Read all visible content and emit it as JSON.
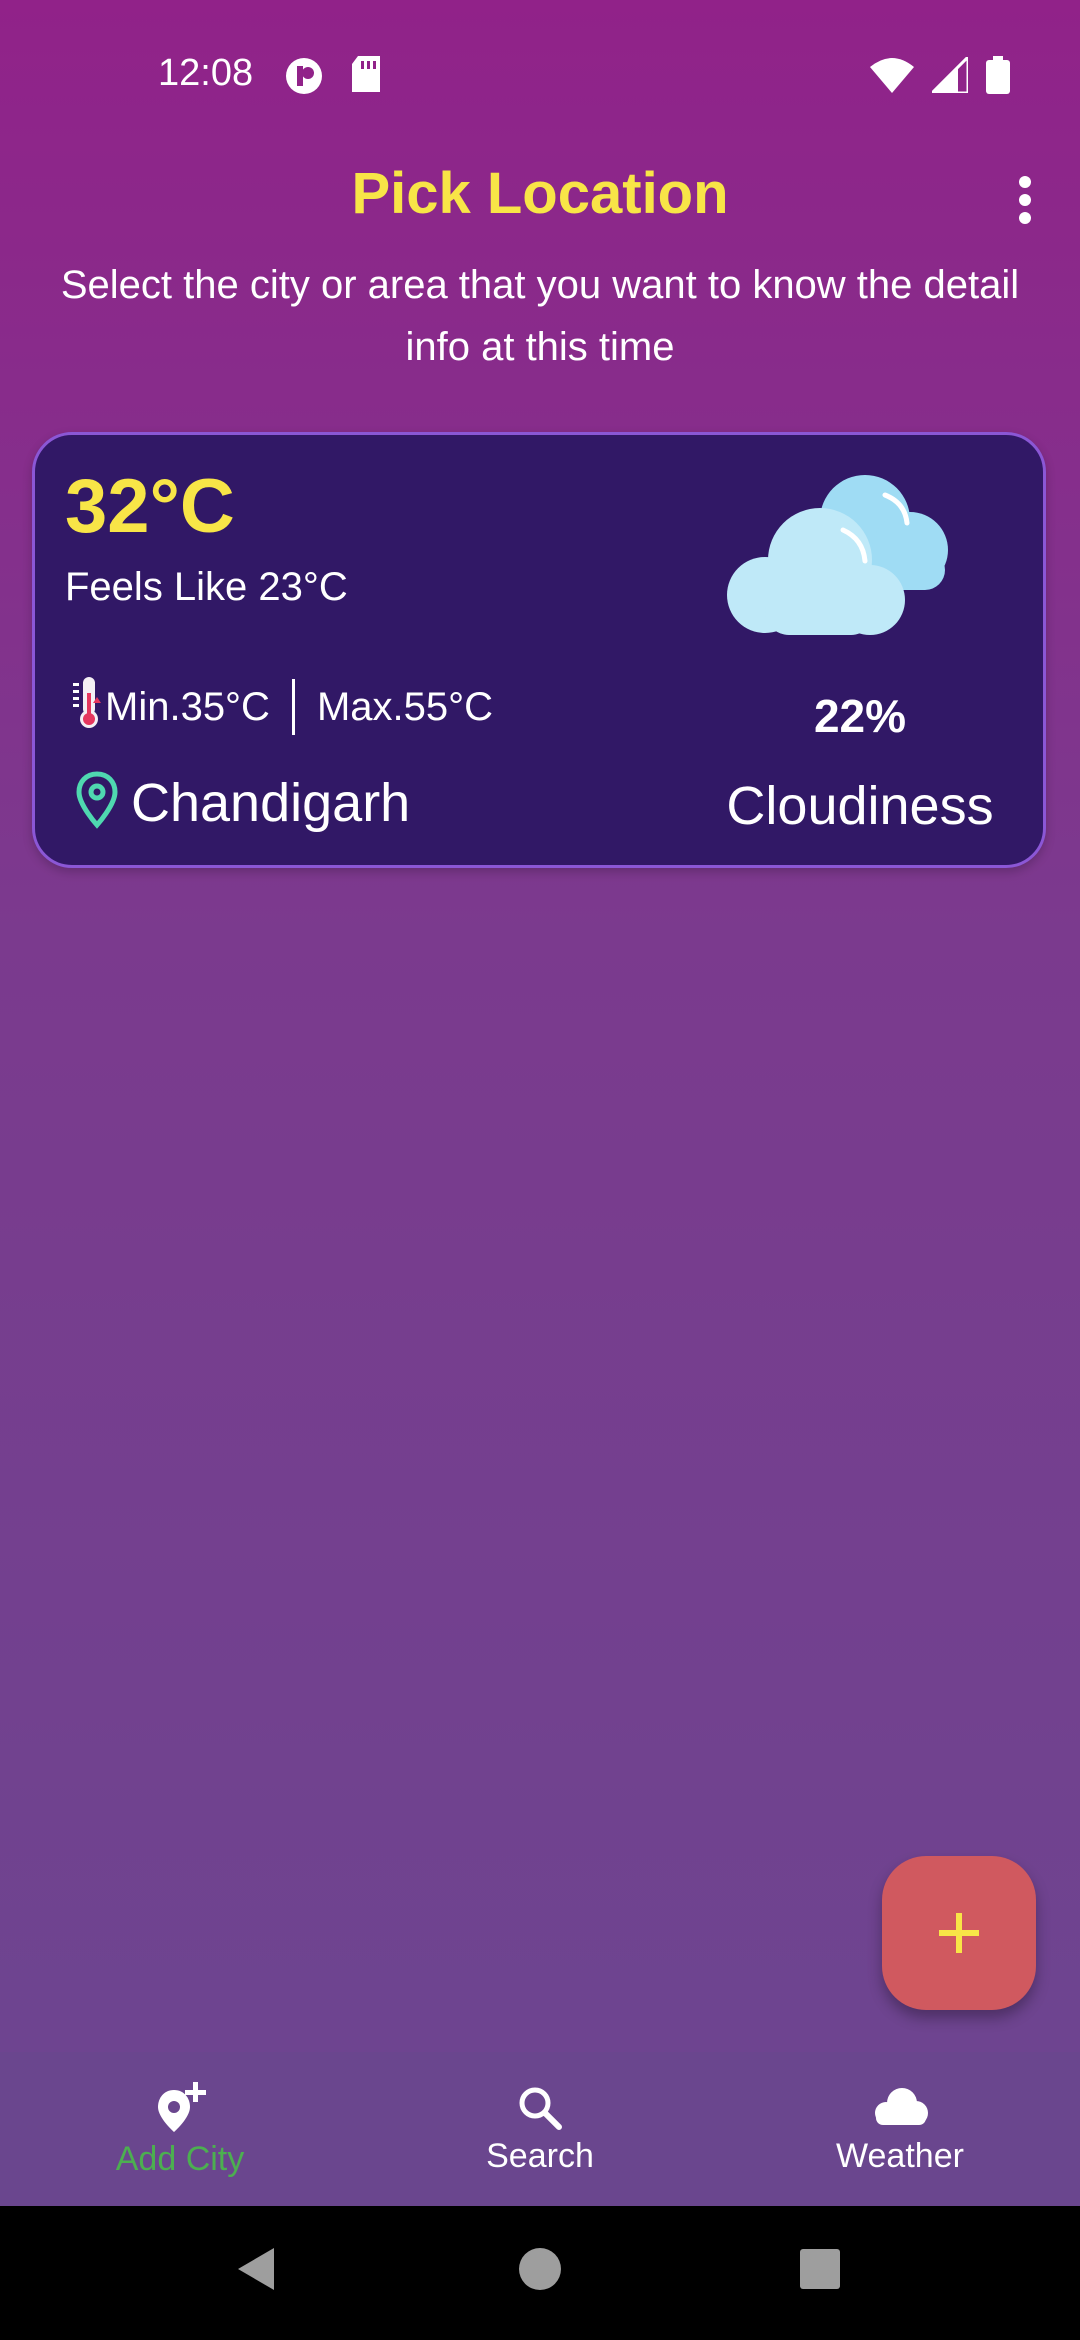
{
  "status_bar": {
    "time": "12:08",
    "icons": [
      "data-saver-icon",
      "sd-card-icon",
      "wifi-icon",
      "signal-icon",
      "battery-icon"
    ]
  },
  "header": {
    "title": "Pick Location",
    "subtitle": "Select the city or area that you want to know the detail info at this time",
    "menu_icon": "more-vert-icon"
  },
  "weather_card": {
    "temperature": "32°C",
    "feels_like": "Feels Like 23°C",
    "min_temp": "Min.35°C",
    "max_temp": "Max.55°C",
    "city": "Chandigarh",
    "cloud_percent": "22%",
    "condition": "Cloudiness",
    "icons": [
      "thermometer-icon",
      "location-pin-icon",
      "cloud-icon"
    ]
  },
  "fab": {
    "icon": "plus-icon"
  },
  "bottom_nav": {
    "items": [
      {
        "label": "Add City",
        "icon": "add-location-icon",
        "active": true
      },
      {
        "label": "Search",
        "icon": "search-icon",
        "active": false
      },
      {
        "label": "Weather",
        "icon": "cloud-icon",
        "active": false
      }
    ]
  },
  "colors": {
    "background_top": "#912289",
    "background_bottom": "#6a4790",
    "accent_yellow": "#f8e547",
    "card_background": "#311866",
    "card_border": "#8b57d6",
    "fab_background": "#d0595f",
    "nav_active": "#4caf50",
    "nav_background": "#6a468e",
    "pin_color": "#4fd8b0"
  }
}
